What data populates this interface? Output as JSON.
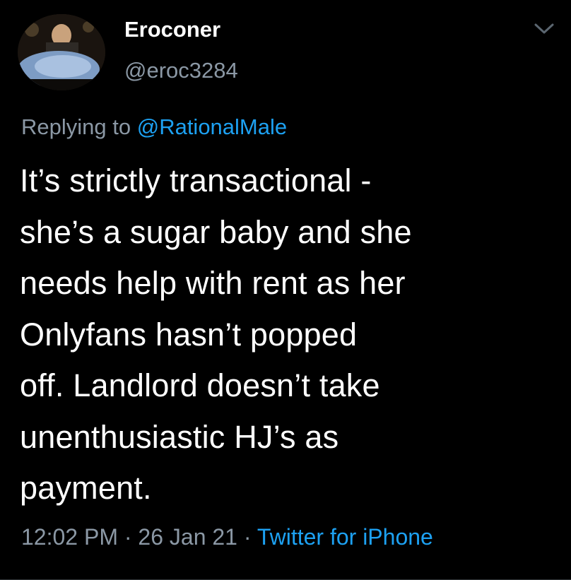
{
  "author": {
    "display_name": "Eroconer",
    "handle": "@eroc3284"
  },
  "reply": {
    "prefix": "Replying to ",
    "mention": "@RationalMale"
  },
  "tweet": {
    "text": "It’s strictly transactional -\nshe’s a sugar baby and she\nneeds help with rent as her\nOnlyfans hasn’t popped\noff. Landlord doesn’t take\nunenthusiastic HJ’s as\npayment."
  },
  "meta": {
    "time": "12:02 PM",
    "sep1": " · ",
    "date": "26 Jan 21",
    "sep2": " · ",
    "source": "Twitter for iPhone"
  },
  "icons": {
    "menu": "chevron-down-icon",
    "avatar": "avatar-photo"
  },
  "colors": {
    "background": "#000000",
    "primary_text": "#ffffff",
    "secondary_text": "#8b98a5",
    "accent": "#1da1f2"
  }
}
